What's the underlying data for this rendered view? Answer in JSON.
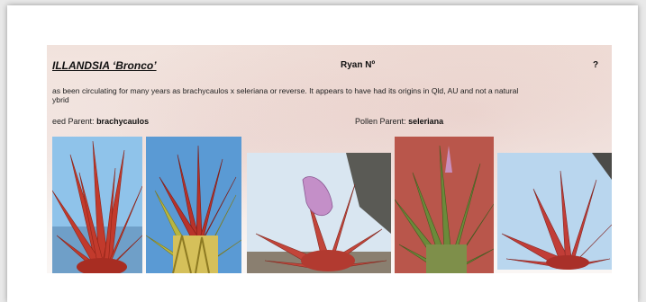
{
  "document": {
    "title": "ILLANDSIA ‘Bronco’",
    "author": "Ryan Nº",
    "question_mark": "?",
    "description_line1": "as been circulating for many years as brachycaulos x seleriana or reverse. It appears to have had its origins in Qld, AU and not a natural",
    "description_line2": "ybrid",
    "seed_parent_label": "eed Parent:",
    "seed_parent_value": "brachycaulos",
    "pollen_parent_label": "Pollen Parent:",
    "pollen_parent_value": "seleriana"
  },
  "photos": [
    {
      "name": "photo-brachycaulos-red"
    },
    {
      "name": "photo-brachycaulos-green"
    },
    {
      "name": "photo-bronco-closeup"
    },
    {
      "name": "photo-seleriana"
    },
    {
      "name": "photo-bronco-red"
    }
  ],
  "colors": {
    "page_background": "#e9e9e9",
    "sheet": "#ffffff",
    "foliage_red": "#c23a2c",
    "foliage_green": "#6b8a3a",
    "sky_blue": "#8fc3ea"
  }
}
